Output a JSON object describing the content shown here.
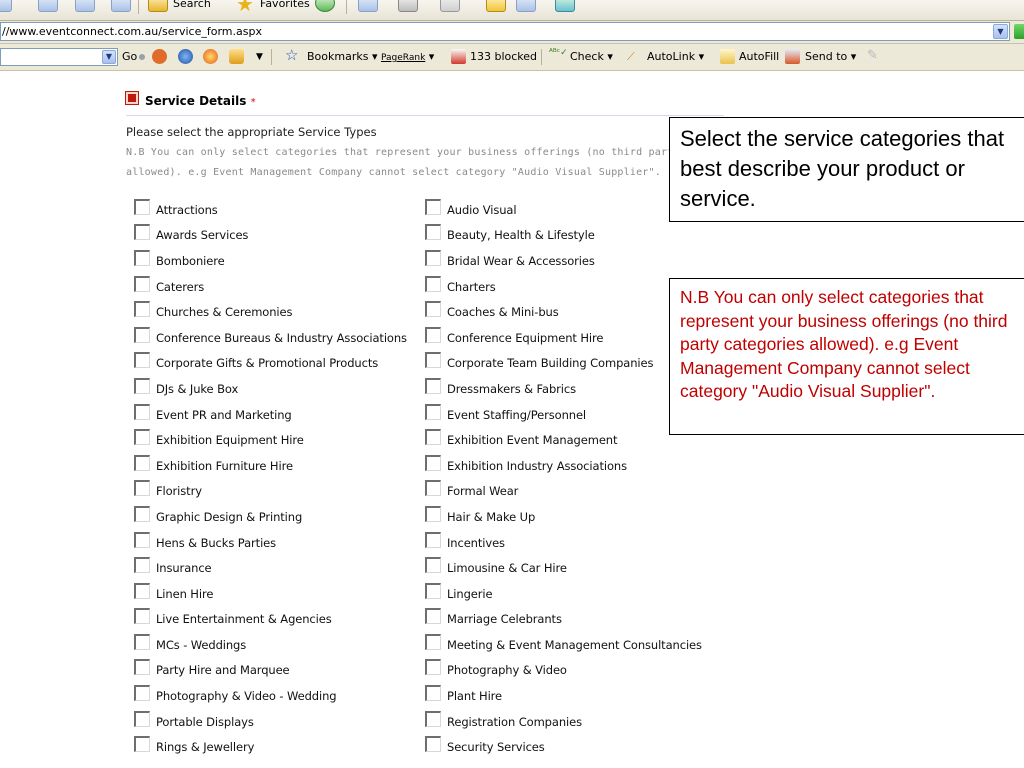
{
  "browser": {
    "toolbar": {
      "search_label": "Search",
      "favorites_label": "Favorites"
    },
    "address": {
      "url": "//www.eventconnect.com.au/service_form.aspx"
    },
    "links_bar": {
      "go_label": "Go",
      "bookmarks_label": "Bookmarks",
      "pagerank_label": "PageRank",
      "blocked_label": "133 blocked",
      "check_label": "Check",
      "autolink_label": "AutoLink",
      "autofill_label": "AutoFill",
      "sendto_label": "Send to"
    }
  },
  "form": {
    "section_title": "Service Details",
    "required_marker": "*",
    "instruction": "Please select the appropriate Service Types",
    "note_line1": "N.B You can only select categories that represent your business offerings (no third party ca",
    "note_line2": "allowed). e.g Event Management Company cannot select category \"Audio Visual Supplier\".",
    "left_column": [
      "Attractions",
      "Awards Services",
      "Bomboniere",
      "Caterers",
      "Churches & Ceremonies",
      "Conference Bureaus & Industry Associations",
      "Corporate Gifts & Promotional Products",
      "DJs & Juke Box",
      "Event PR and Marketing",
      "Exhibition Equipment Hire",
      "Exhibition Furniture Hire",
      "Floristry",
      "Graphic Design & Printing",
      "Hens & Bucks Parties",
      "Insurance",
      "Linen Hire",
      "Live Entertainment & Agencies",
      "MCs - Weddings",
      "Party Hire and Marquee",
      "Photography & Video - Wedding",
      "Portable Displays",
      "Rings & Jewellery"
    ],
    "right_column": [
      "Audio Visual",
      "Beauty, Health & Lifestyle",
      "Bridal Wear & Accessories",
      "Charters",
      "Coaches & Mini-bus",
      "Conference Equipment Hire",
      "Corporate Team Building Companies",
      "Dressmakers & Fabrics",
      "Event Staffing/Personnel",
      "Exhibition Event Management",
      "Exhibition Industry Associations",
      "Formal Wear",
      "Hair & Make Up",
      "Incentives",
      "Limousine & Car Hire",
      "Lingerie",
      "Marriage Celebrants",
      "Meeting & Event Management Consultancies",
      "Photography & Video",
      "Plant Hire",
      "Registration Companies",
      "Security Services"
    ]
  },
  "callouts": {
    "primary": "Select the service categories that best describe your product or service.",
    "note": "N.B You can only select categories that represent your business offerings (no third party categories allowed). e.g Event Management Company cannot select category \"Audio Visual Supplier\"."
  },
  "colors": {
    "note_text": "#c00000",
    "required_star": "#d60000",
    "section_icon": "#c0180a"
  }
}
